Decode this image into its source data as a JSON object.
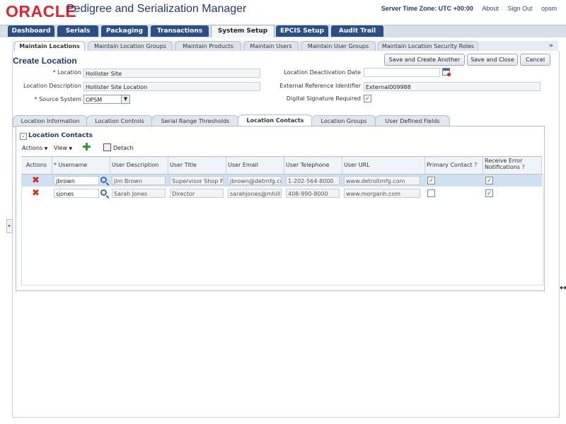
{
  "header": {
    "logo": "ORACLE",
    "app_title": "Pedigree and Serialization Manager",
    "server_tz": "Server Time Zone: UTC +00:00",
    "links": [
      "About",
      "Sign Out",
      "opsm"
    ]
  },
  "main_tabs": [
    "Dashboard",
    "Serials",
    "Packaging",
    "Transactions",
    "System Setup",
    "EPCIS Setup",
    "Audit Trail"
  ],
  "sub_tabs": [
    "Maintain Locations",
    "Maintain Location Groups",
    "Maintain Products",
    "Maintain Users",
    "Maintain User Groups",
    "Maintain Location Security Roles"
  ],
  "sub_more": "»",
  "page": {
    "title": "Create Location",
    "buttons": [
      "Save and Create Another",
      "Save and Close",
      "Cancel"
    ]
  },
  "form": {
    "location_label": "* Location",
    "location_value": "Hollister Site",
    "description_label": "Location Description",
    "description_value": "Hollister Site Location",
    "source_label": "* Source System",
    "source_value": "OPSM",
    "deactivation_label": "Location Deactivation Date",
    "deactivation_value": "",
    "extref_label": "External Reference Identifier",
    "extref_value": "External009988",
    "digsig_label": "Digital Signature Required",
    "digsig_checked": true
  },
  "inner_tabs": [
    "Location Information",
    "Location Controls",
    "Serial Range Thresholds",
    "Location Contacts",
    "Location Groups",
    "User Defined Fields"
  ],
  "contacts": {
    "section_title": "Location Contacts",
    "actions_menu": "Actions",
    "view_menu": "View",
    "detach": "Detach",
    "columns": [
      "Actions",
      "* Username",
      "User Description",
      "User Title",
      "User Email",
      "User Telephone",
      "User URL",
      "Primary Contact",
      "Receive Error Notifications"
    ],
    "rows": [
      {
        "username": "jbrown",
        "description": "Jim Brown",
        "title": "Supervisor Shop Fl",
        "email": "jbrown@detmfg.co",
        "phone": "1-202-564-8000",
        "url": "www.detroitmfg.com",
        "primary": true,
        "notify": true
      },
      {
        "username": "sjones",
        "description": "Sarah Jones",
        "title": "Director",
        "email": "sarahjones@mhill.c",
        "phone": "408-990-8000",
        "url": "www.morganh.com",
        "primary": false,
        "notify": true
      }
    ]
  },
  "colors": {
    "brand_red": "#e0262e",
    "tab_blue": "#2a4f86",
    "title_blue": "#223a6e",
    "selected_row": "#cfe0f3"
  }
}
